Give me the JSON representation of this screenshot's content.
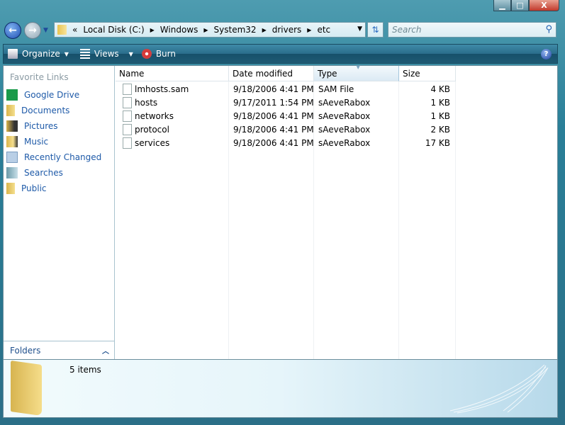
{
  "window": {
    "minimize": "▁",
    "maximize": "□",
    "close": "X"
  },
  "address": {
    "overflow": "«",
    "crumbs": [
      "Local Disk (C:)",
      "Windows",
      "System32",
      "drivers",
      "etc"
    ]
  },
  "search": {
    "placeholder": "Search"
  },
  "toolbar": {
    "organize": "Organize",
    "views": "Views",
    "burn": "Burn",
    "help": "?"
  },
  "nav": {
    "title": "Favorite Links",
    "items": [
      {
        "label": "Google Drive",
        "icon": "google-drive-icon"
      },
      {
        "label": "Documents",
        "icon": "folder-icon"
      },
      {
        "label": "Pictures",
        "icon": "pictures-folder-icon"
      },
      {
        "label": "Music",
        "icon": "music-folder-icon"
      },
      {
        "label": "Recently Changed",
        "icon": "recently-changed-icon"
      },
      {
        "label": "Searches",
        "icon": "searches-icon"
      },
      {
        "label": "Public",
        "icon": "folder-icon"
      }
    ],
    "folders": "Folders"
  },
  "columns": [
    "Name",
    "Date modified",
    "Type",
    "Size"
  ],
  "files": [
    {
      "name": "lmhosts.sam",
      "date": "9/18/2006 4:41 PM",
      "type": "SAM File",
      "size": "4 KB"
    },
    {
      "name": "hosts",
      "date": "9/17/2011 1:54 PM",
      "type": "sAeveRabox",
      "size": "1 KB"
    },
    {
      "name": "networks",
      "date": "9/18/2006 4:41 PM",
      "type": "sAeveRabox",
      "size": "1 KB"
    },
    {
      "name": "protocol",
      "date": "9/18/2006 4:41 PM",
      "type": "sAeveRabox",
      "size": "2 KB"
    },
    {
      "name": "services",
      "date": "9/18/2006 4:41 PM",
      "type": "sAeveRabox",
      "size": "17 KB"
    }
  ],
  "details": {
    "count": "5 items"
  },
  "colors": {
    "frame": "#2a7f98",
    "link": "#1e5aa8",
    "toolbar": "#1f5a74"
  }
}
